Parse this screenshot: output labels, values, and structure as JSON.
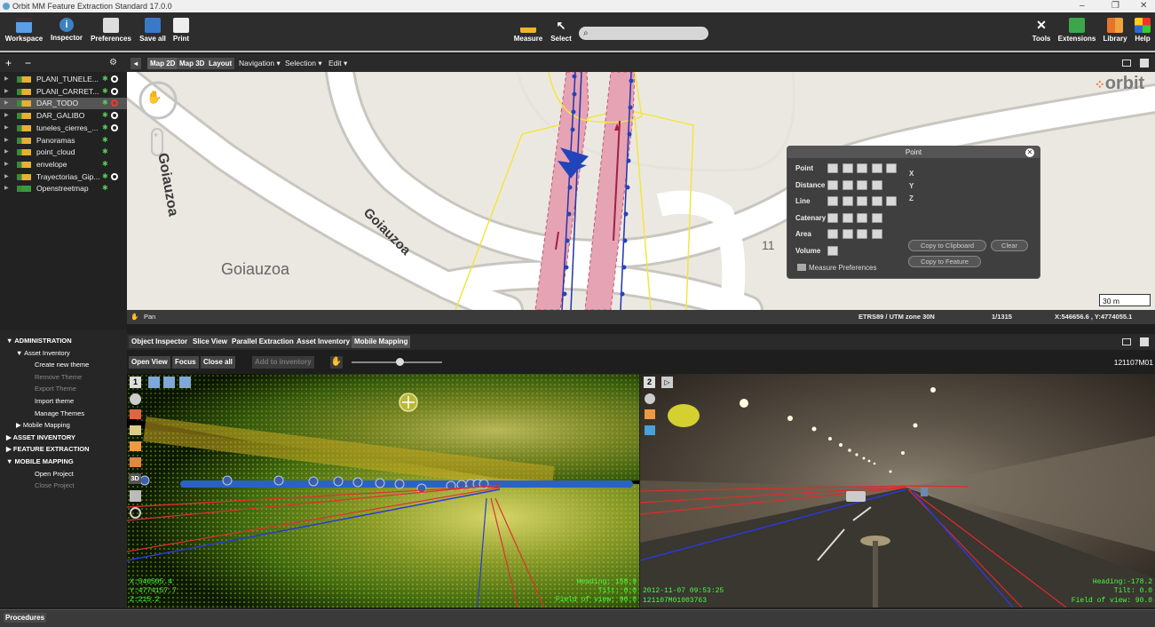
{
  "window": {
    "title": "Orbit MM Feature Extraction Standard 17.0.0",
    "controls": [
      "‒",
      "❐",
      "✕"
    ]
  },
  "toolbar": {
    "left": [
      {
        "label": "Workspace",
        "icon": "workspace-icon"
      },
      {
        "label": "Inspector",
        "icon": "info-icon"
      },
      {
        "label": "Preferences",
        "icon": "preferences-icon"
      },
      {
        "label": "Save all",
        "icon": "save-icon"
      },
      {
        "label": "Print",
        "icon": "print-icon"
      }
    ],
    "measure": "Measure",
    "select": "Select",
    "search_placeholder": "",
    "right": [
      {
        "label": "Tools"
      },
      {
        "label": "Extensions"
      },
      {
        "label": "Library"
      },
      {
        "label": "Help"
      }
    ]
  },
  "layers": {
    "header": {
      "add": "+",
      "remove": "−",
      "gear": "⚙"
    },
    "items": [
      {
        "name": "PLANI_TUNELE...",
        "type": "line",
        "visible": true
      },
      {
        "name": "PLANI_CARRET...",
        "type": "line",
        "visible": true
      },
      {
        "name": "DAR_TODO",
        "type": "point",
        "visible": true,
        "selected": true
      },
      {
        "name": "DAR_GALIBO",
        "type": "point",
        "visible": true
      },
      {
        "name": "tuneles_cierres_...",
        "type": "line",
        "visible": true
      },
      {
        "name": "Panoramas",
        "type": "point",
        "visible": false
      },
      {
        "name": "point_cloud",
        "type": "cloud",
        "visible": false
      },
      {
        "name": "envelope",
        "type": "area",
        "visible": false
      },
      {
        "name": "Trayectorias_Gip...",
        "type": "line",
        "visible": true
      },
      {
        "name": "Openstreetmap",
        "type": "raster",
        "visible": false
      }
    ]
  },
  "map": {
    "tabs": [
      "Map 2D",
      "Map 3D",
      "Layout"
    ],
    "menus": [
      "Navigation ▾",
      "Selection ▾",
      "Edit ▾"
    ],
    "labels": [
      "Goiauzoa",
      "Goiauzoa",
      "Goiauzoa",
      "11"
    ],
    "brand": "orbit",
    "scale_bar": "30 m",
    "status": {
      "tool": "Pan",
      "crs": "ETRS89 / UTM zone 30N",
      "scale": "1/1315",
      "coords": "X:546656.6 , Y:4774055.1"
    }
  },
  "point_panel": {
    "title": "Point",
    "rows": [
      {
        "label": "Point",
        "buttons": 5
      },
      {
        "label": "Distance",
        "buttons": 4
      },
      {
        "label": "Line",
        "buttons": 5
      },
      {
        "label": "Catenary",
        "buttons": 4
      },
      {
        "label": "Area",
        "buttons": 4
      },
      {
        "label": "Volume",
        "buttons": 1
      }
    ],
    "axes": [
      "X",
      "Y",
      "Z"
    ],
    "copy_clipboard": "Copy to Clipboard",
    "clear": "Clear",
    "copy_feature": "Copy to Feature",
    "prefs": "Measure Preferences"
  },
  "tree": [
    {
      "label": "ADMINISTRATION",
      "level": 0,
      "bold": true,
      "open": true
    },
    {
      "label": "Asset Inventory",
      "level": 1,
      "open": true
    },
    {
      "label": "Create new theme",
      "level": 2
    },
    {
      "label": "Remove Theme",
      "level": 2,
      "dim": true
    },
    {
      "label": "Export Theme",
      "level": 2,
      "dim": true
    },
    {
      "label": "Import theme",
      "level": 2
    },
    {
      "label": "Manage Themes",
      "level": 2
    },
    {
      "label": "Mobile Mapping",
      "level": 1,
      "open": false
    },
    {
      "label": "ASSET INVENTORY",
      "level": 0,
      "bold": true,
      "open": false
    },
    {
      "label": "FEATURE EXTRACTION",
      "level": 0,
      "bold": true,
      "open": false
    },
    {
      "label": "MOBILE MAPPING",
      "level": 0,
      "bold": true,
      "open": true
    },
    {
      "label": "Open Project",
      "level": 2
    },
    {
      "label": "Close Project",
      "level": 2,
      "dim": true
    }
  ],
  "bottom_tabs": [
    "Object Inspector",
    "Slice View",
    "Parallel Extraction",
    "Asset Inventory",
    "Mobile Mapping"
  ],
  "mm": {
    "open_view": "Open View",
    "focus": "Focus",
    "close_all": "Close all",
    "add_inventory": "Add to inventory",
    "slider": 0.53,
    "run_id": "121107M01",
    "pc": {
      "view_no": "1",
      "badge3d": "3D",
      "x": "X:546505.4",
      "y": "Y:4774157.7",
      "z": "Z:215.2",
      "heading": "Heading: 158.9",
      "tilt": "Tilt:   0.0",
      "fov": "Field of view: 90.0"
    },
    "photo": {
      "view_no": "2",
      "date": "2012-11-07 09:53:25",
      "frame": "121107M01003763",
      "heading": "Heading:-178.2",
      "tilt": "Tilt:   0.0",
      "fov": "Field of view: 90.0"
    }
  },
  "procedures": "Procedures"
}
